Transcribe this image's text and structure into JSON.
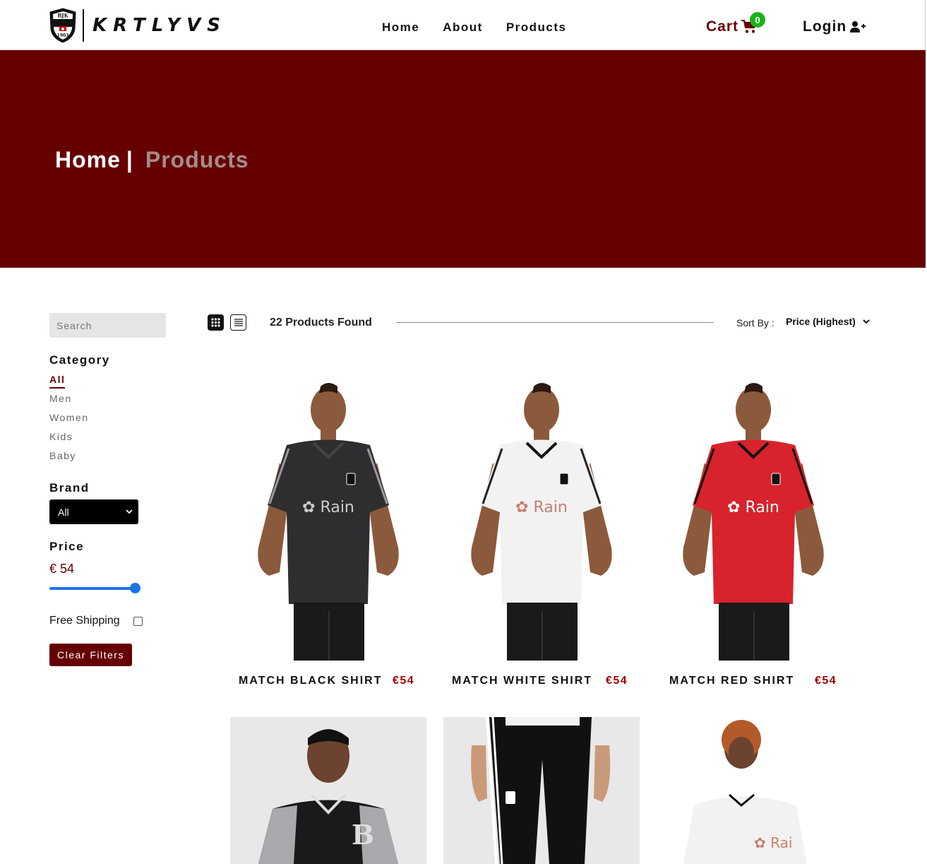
{
  "nav": {
    "logo_crest_text": [
      "BJK",
      "1903"
    ],
    "brand": "KRTLYVS",
    "links": [
      "Home",
      "About",
      "Products"
    ],
    "cart_label": "Cart",
    "cart_count": "0",
    "login_label": "Login",
    "cart_icon": "shopping-cart-icon",
    "login_icon": "user-plus-icon"
  },
  "hero": {
    "home": "Home",
    "separator": "|",
    "current": "Products"
  },
  "filters": {
    "search_placeholder": "Search",
    "category_heading": "Category",
    "categories": [
      "All",
      "Men",
      "Women",
      "Kids",
      "Baby"
    ],
    "active_category": "All",
    "brand_heading": "Brand",
    "brand_selected": "All",
    "price_heading": "Price",
    "price_value": "€ 54",
    "price_slider_fraction": 1.0,
    "free_shipping_label": "Free Shipping",
    "free_shipping_checked": false,
    "clear_label": "Clear Filters"
  },
  "toolbar": {
    "found": "22 Products Found",
    "sort_label": "Sort By :",
    "sort_selected": "Price (Highest)",
    "view_grid_icon": "grid-view-icon",
    "view_list_icon": "list-view-icon"
  },
  "products": [
    {
      "name": "MATCH BLACK SHIRT",
      "price": "€54",
      "shirt_color": "#2e2e30"
    },
    {
      "name": "MATCH WHITE SHIRT",
      "price": "€54",
      "shirt_color": "#f2f2f2"
    },
    {
      "name": "MATCH RED SHIRT",
      "price": "€54",
      "shirt_color": "#d8222c"
    },
    {
      "name": "",
      "price": "",
      "shirt_color": "#111111"
    },
    {
      "name": "",
      "price": "",
      "shirt_color": "#111111"
    },
    {
      "name": "",
      "price": "",
      "shirt_color": "#f2f2f2"
    }
  ],
  "colors": {
    "accent": "#660000",
    "price": "#a00000",
    "badge": "#19b319",
    "slider": "#1a73e8"
  }
}
